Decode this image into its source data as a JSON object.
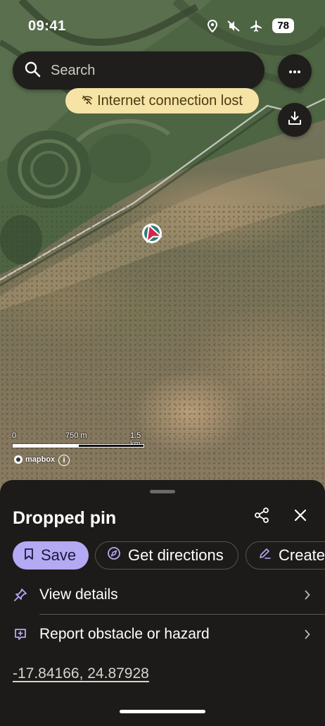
{
  "status_bar": {
    "time": "09:41",
    "battery": "78",
    "icons": [
      "location-icon",
      "mute-icon",
      "airplane-icon"
    ]
  },
  "search": {
    "placeholder": "Search",
    "icon": "search-icon"
  },
  "map": {
    "offline_banner": "Internet connection lost",
    "scale": {
      "zero": "0",
      "mid": "750 m",
      "end": "1.5 km"
    },
    "attribution": "mapbox",
    "info_label": "i"
  },
  "sheet": {
    "title": "Dropped pin",
    "actions": {
      "save": "Save",
      "directions": "Get directions",
      "create": "Create"
    },
    "rows": [
      {
        "label": "View details",
        "icon": "pin-icon"
      },
      {
        "label": "Report obstacle or hazard",
        "icon": "report-icon"
      }
    ],
    "coordinates": "-17.84166, 24.87928"
  },
  "colors": {
    "sheet_bg": "#1d1b19",
    "accent": "#b3aaf3",
    "banner_bg": "#f6e3a6",
    "pin": "#d8234a"
  }
}
